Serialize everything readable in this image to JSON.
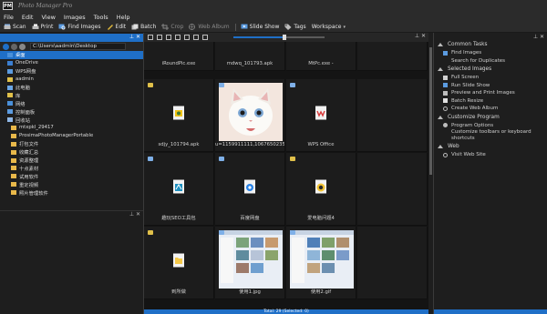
{
  "app": {
    "title": "Photo Manager Pro",
    "logo_text": "PM"
  },
  "menu": [
    "File",
    "Edit",
    "View",
    "Images",
    "Tools",
    "Help"
  ],
  "toolbar": {
    "scan": "Scan",
    "print": "Print",
    "find_images": "Find Images",
    "edit": "Edit",
    "batch": "Batch",
    "crop": "Crop",
    "web_album": "Web Album",
    "slide_show": "Slide Show",
    "tags": "Tags",
    "workspace": "Workspace"
  },
  "left_pane": {
    "path": "C:\\Users\\aadmin\\Desktop",
    "tree": [
      {
        "label": "桌面",
        "selected": true
      },
      {
        "label": "OneDrive"
      },
      {
        "label": "WPS网盘"
      },
      {
        "label": "aadmin"
      },
      {
        "label": "此电脑"
      },
      {
        "label": "库"
      },
      {
        "label": "网络"
      },
      {
        "label": "控制面板"
      },
      {
        "label": "回收站"
      },
      {
        "label": "mtxpkl_29417",
        "sub": true
      },
      {
        "label": "ProsimaPhotoManagerPortable",
        "sub": true
      },
      {
        "label": "打包文件",
        "sub": true
      },
      {
        "label": "收藏汇总",
        "sub": true
      },
      {
        "label": "资源整理",
        "sub": true
      },
      {
        "label": "十点素材",
        "sub": true
      },
      {
        "label": "试用软件",
        "sub": true
      },
      {
        "label": "重定视频",
        "sub": true
      },
      {
        "label": "照片管理软件",
        "sub": true
      }
    ]
  },
  "grid": {
    "items": [
      {
        "caption": "iRoundPic.exe"
      },
      {
        "caption": "mdwq_101793.apk"
      },
      {
        "caption": "MtPc.exe - "
      },
      {
        "caption": "sdjy_101794.apk"
      },
      {
        "caption": "u=1159911111,1067650235&f..."
      },
      {
        "caption": "WPS Office"
      },
      {
        "caption": "趣玩SEO工具包"
      },
      {
        "caption": "百度网盘"
      },
      {
        "caption": "爱电脑问题4"
      },
      {
        "caption": "到所做"
      },
      {
        "caption": "使用1.jpg"
      },
      {
        "caption": "使用2.gif"
      }
    ]
  },
  "status": {
    "text": "Total: 29 (Selected: 0)"
  },
  "tasks": {
    "common_header": "Common Tasks",
    "find_images": "Find Images",
    "search_duplicates": "Search for Duplicates",
    "selected_header": "Selected Images",
    "full_screen": "Full Screen",
    "run_slide_show": "Run Slide Show",
    "preview_print": "Preview and Print Images",
    "batch_resize": "Batch Resize",
    "create_web_album": "Create Web Album",
    "customize_header": "Customize Program",
    "program_options": "Program Options",
    "customize_toolbars": "Customize toolbars or keyboard shortcuts",
    "web_header": "Web",
    "visit_web_site": "Visit Web Site"
  },
  "colors": {
    "accent": "#1f6fc7",
    "background": "#1e1e1e",
    "panel": "#2b2b2b"
  }
}
